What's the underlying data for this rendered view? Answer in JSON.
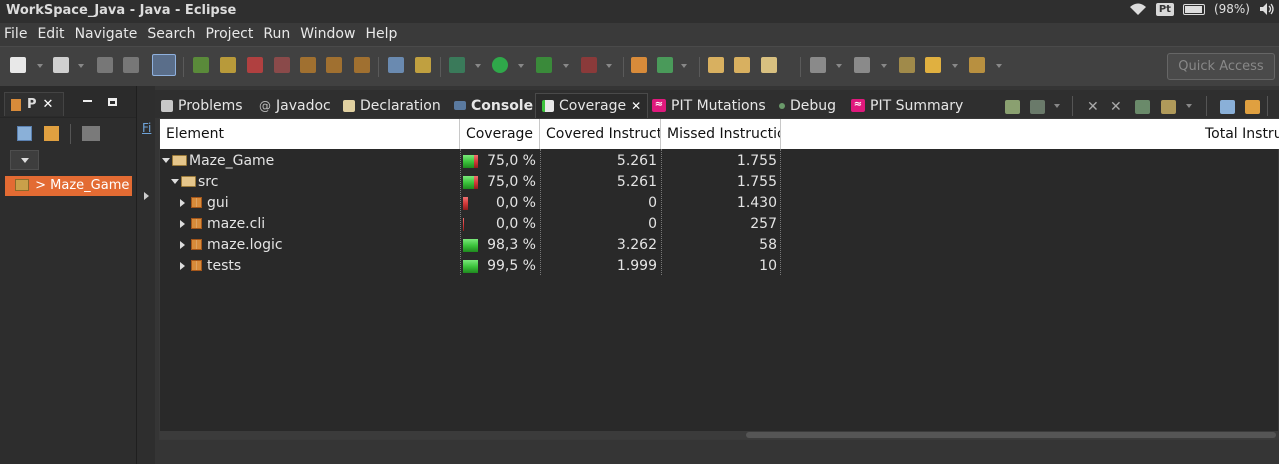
{
  "window": {
    "title": "WorkSpace_Java - Java - Eclipse",
    "tray_keyboard": "Pt",
    "battery": "(98%)"
  },
  "menu": [
    "File",
    "Edit",
    "Navigate",
    "Search",
    "Project",
    "Run",
    "Window",
    "Help"
  ],
  "toolbar": {
    "quick_access_placeholder": "Quick Access"
  },
  "left_panel": {
    "tab_label": "P",
    "tab_close": "✕",
    "tree_item": "> Maze_Game"
  },
  "mid_strip": {
    "link": "Fi"
  },
  "view_tabs": [
    {
      "label": "Problems",
      "icon": "problems-icon"
    },
    {
      "label": "Javadoc",
      "icon": "javadoc-icon"
    },
    {
      "label": "Declaration",
      "icon": "declaration-icon"
    },
    {
      "label": "Console",
      "icon": "console-icon"
    },
    {
      "label": "Coverage",
      "icon": "coverage-icon",
      "active": true,
      "close": "✕"
    },
    {
      "label": "PIT Mutations",
      "icon": "pit-icon"
    },
    {
      "label": "Debug",
      "icon": "debug-icon"
    },
    {
      "label": "PIT Summary",
      "icon": "pit-icon"
    }
  ],
  "table": {
    "columns": [
      "Element",
      "Coverage",
      "Covered Instruct",
      "Missed Instructic",
      "Total Instru"
    ],
    "rows": [
      {
        "element": "Maze_Game",
        "coverage": "75,0 %",
        "covered": "5.261",
        "missed": "1.755",
        "ratio": 0.75
      },
      {
        "element": "src",
        "coverage": "75,0 %",
        "covered": "5.261",
        "missed": "1.755",
        "ratio": 0.75
      },
      {
        "element": "gui",
        "coverage": "0,0 %",
        "covered": "0",
        "missed": "1.430",
        "ratio": 0.0
      },
      {
        "element": "maze.cli",
        "coverage": "0,0 %",
        "covered": "0",
        "missed": "257",
        "ratio": 0.0
      },
      {
        "element": "maze.logic",
        "coverage": "98,3 %",
        "covered": "3.262",
        "missed": "58",
        "ratio": 0.983
      },
      {
        "element": "tests",
        "coverage": "99,5 %",
        "covered": "1.999",
        "missed": "10",
        "ratio": 0.995
      }
    ]
  },
  "colors": {
    "covered": "#3cc43c",
    "missed": "#d43a3a",
    "selection": "#e36b33",
    "pit": "#e0197d"
  }
}
